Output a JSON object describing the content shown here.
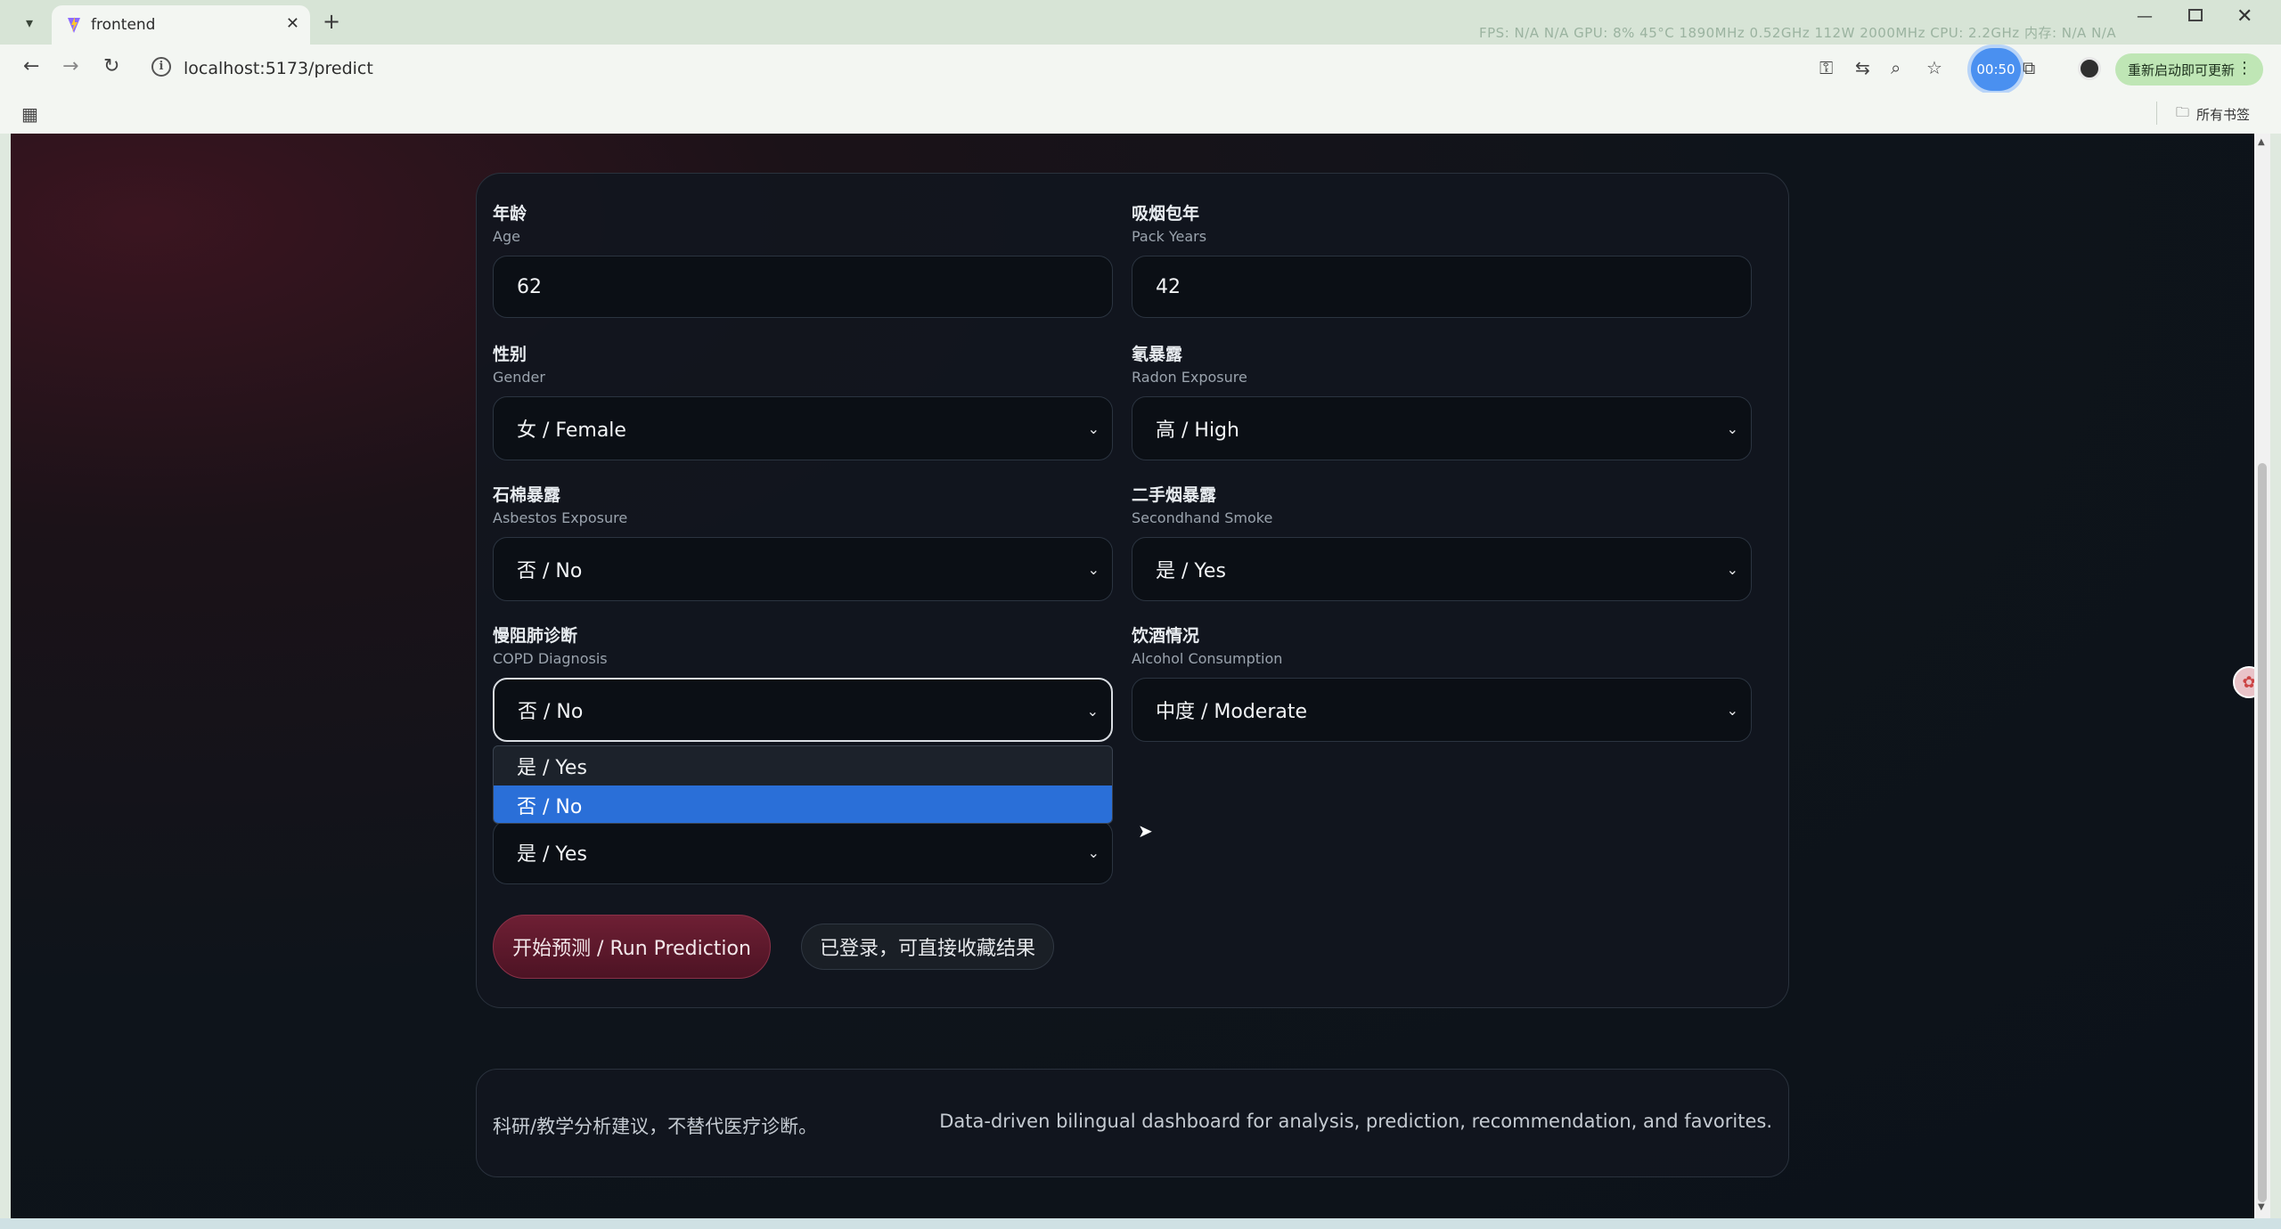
{
  "browser": {
    "tab_title": "frontend",
    "url": "localhost:5173/predict",
    "hud_text": "FPS: N/A N/A   GPU: 8% 45°C 1890MHz 0.52GHz 112W 2000MHz   CPU: 2.2GHz   内存: N/A N/A",
    "timer": "00:50",
    "update_label": "重新启动即可更新",
    "all_bookmarks": "所有书签"
  },
  "form": {
    "age": {
      "label_cn": "年龄",
      "label_en": "Age",
      "value": "62"
    },
    "pack_years": {
      "label_cn": "吸烟包年",
      "label_en": "Pack Years",
      "value": "42"
    },
    "gender": {
      "label_cn": "性别",
      "label_en": "Gender",
      "value": "女 / Female"
    },
    "radon": {
      "label_cn": "氡暴露",
      "label_en": "Radon Exposure",
      "value": "高 / High"
    },
    "asbestos": {
      "label_cn": "石棉暴露",
      "label_en": "Asbestos Exposure",
      "value": "否 / No"
    },
    "secondhand": {
      "label_cn": "二手烟暴露",
      "label_en": "Secondhand Smoke",
      "value": "是 / Yes"
    },
    "copd": {
      "label_cn": "慢阻肺诊断",
      "label_en": "COPD Diagnosis",
      "value": "否 / No",
      "options": [
        "是 / Yes",
        "否 / No"
      ]
    },
    "alcohol": {
      "label_cn": "饮酒情况",
      "label_en": "Alcohol Consumption",
      "value": "中度 / Moderate"
    },
    "family_history": {
      "value": "是 / Yes"
    },
    "run_button": "开始预测 / Run Prediction",
    "login_note": "已登录，可直接收藏结果"
  },
  "footer": {
    "disclaimer_cn": "科研/教学分析建议，不替代医疗诊断。",
    "tagline_en": "Data-driven bilingual dashboard for analysis, prediction, recommendation, and favorites."
  },
  "colors": {
    "accent_blue": "#2a6fd8",
    "run_button": "#6e1f34",
    "page_bg": "#0e141b"
  }
}
